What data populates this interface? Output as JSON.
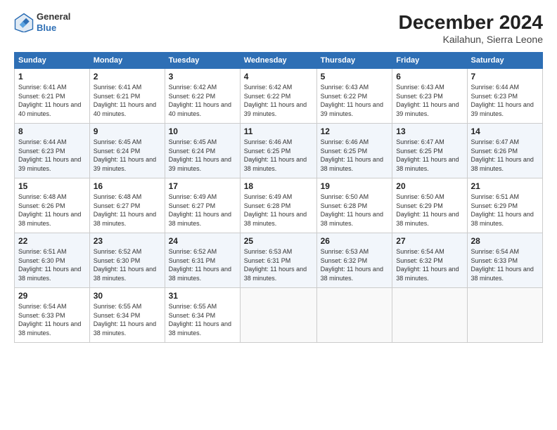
{
  "header": {
    "logo_general": "General",
    "logo_blue": "Blue",
    "month_title": "December 2024",
    "location": "Kailahun, Sierra Leone"
  },
  "days_of_week": [
    "Sunday",
    "Monday",
    "Tuesday",
    "Wednesday",
    "Thursday",
    "Friday",
    "Saturday"
  ],
  "weeks": [
    [
      {
        "day": "1",
        "info": "Sunrise: 6:41 AM\nSunset: 6:21 PM\nDaylight: 11 hours and 40 minutes."
      },
      {
        "day": "2",
        "info": "Sunrise: 6:41 AM\nSunset: 6:21 PM\nDaylight: 11 hours and 40 minutes."
      },
      {
        "day": "3",
        "info": "Sunrise: 6:42 AM\nSunset: 6:22 PM\nDaylight: 11 hours and 40 minutes."
      },
      {
        "day": "4",
        "info": "Sunrise: 6:42 AM\nSunset: 6:22 PM\nDaylight: 11 hours and 39 minutes."
      },
      {
        "day": "5",
        "info": "Sunrise: 6:43 AM\nSunset: 6:22 PM\nDaylight: 11 hours and 39 minutes."
      },
      {
        "day": "6",
        "info": "Sunrise: 6:43 AM\nSunset: 6:23 PM\nDaylight: 11 hours and 39 minutes."
      },
      {
        "day": "7",
        "info": "Sunrise: 6:44 AM\nSunset: 6:23 PM\nDaylight: 11 hours and 39 minutes."
      }
    ],
    [
      {
        "day": "8",
        "info": "Sunrise: 6:44 AM\nSunset: 6:23 PM\nDaylight: 11 hours and 39 minutes."
      },
      {
        "day": "9",
        "info": "Sunrise: 6:45 AM\nSunset: 6:24 PM\nDaylight: 11 hours and 39 minutes."
      },
      {
        "day": "10",
        "info": "Sunrise: 6:45 AM\nSunset: 6:24 PM\nDaylight: 11 hours and 39 minutes."
      },
      {
        "day": "11",
        "info": "Sunrise: 6:46 AM\nSunset: 6:25 PM\nDaylight: 11 hours and 38 minutes."
      },
      {
        "day": "12",
        "info": "Sunrise: 6:46 AM\nSunset: 6:25 PM\nDaylight: 11 hours and 38 minutes."
      },
      {
        "day": "13",
        "info": "Sunrise: 6:47 AM\nSunset: 6:25 PM\nDaylight: 11 hours and 38 minutes."
      },
      {
        "day": "14",
        "info": "Sunrise: 6:47 AM\nSunset: 6:26 PM\nDaylight: 11 hours and 38 minutes."
      }
    ],
    [
      {
        "day": "15",
        "info": "Sunrise: 6:48 AM\nSunset: 6:26 PM\nDaylight: 11 hours and 38 minutes."
      },
      {
        "day": "16",
        "info": "Sunrise: 6:48 AM\nSunset: 6:27 PM\nDaylight: 11 hours and 38 minutes."
      },
      {
        "day": "17",
        "info": "Sunrise: 6:49 AM\nSunset: 6:27 PM\nDaylight: 11 hours and 38 minutes."
      },
      {
        "day": "18",
        "info": "Sunrise: 6:49 AM\nSunset: 6:28 PM\nDaylight: 11 hours and 38 minutes."
      },
      {
        "day": "19",
        "info": "Sunrise: 6:50 AM\nSunset: 6:28 PM\nDaylight: 11 hours and 38 minutes."
      },
      {
        "day": "20",
        "info": "Sunrise: 6:50 AM\nSunset: 6:29 PM\nDaylight: 11 hours and 38 minutes."
      },
      {
        "day": "21",
        "info": "Sunrise: 6:51 AM\nSunset: 6:29 PM\nDaylight: 11 hours and 38 minutes."
      }
    ],
    [
      {
        "day": "22",
        "info": "Sunrise: 6:51 AM\nSunset: 6:30 PM\nDaylight: 11 hours and 38 minutes."
      },
      {
        "day": "23",
        "info": "Sunrise: 6:52 AM\nSunset: 6:30 PM\nDaylight: 11 hours and 38 minutes."
      },
      {
        "day": "24",
        "info": "Sunrise: 6:52 AM\nSunset: 6:31 PM\nDaylight: 11 hours and 38 minutes."
      },
      {
        "day": "25",
        "info": "Sunrise: 6:53 AM\nSunset: 6:31 PM\nDaylight: 11 hours and 38 minutes."
      },
      {
        "day": "26",
        "info": "Sunrise: 6:53 AM\nSunset: 6:32 PM\nDaylight: 11 hours and 38 minutes."
      },
      {
        "day": "27",
        "info": "Sunrise: 6:54 AM\nSunset: 6:32 PM\nDaylight: 11 hours and 38 minutes."
      },
      {
        "day": "28",
        "info": "Sunrise: 6:54 AM\nSunset: 6:33 PM\nDaylight: 11 hours and 38 minutes."
      }
    ],
    [
      {
        "day": "29",
        "info": "Sunrise: 6:54 AM\nSunset: 6:33 PM\nDaylight: 11 hours and 38 minutes."
      },
      {
        "day": "30",
        "info": "Sunrise: 6:55 AM\nSunset: 6:34 PM\nDaylight: 11 hours and 38 minutes."
      },
      {
        "day": "31",
        "info": "Sunrise: 6:55 AM\nSunset: 6:34 PM\nDaylight: 11 hours and 38 minutes."
      },
      null,
      null,
      null,
      null
    ]
  ]
}
